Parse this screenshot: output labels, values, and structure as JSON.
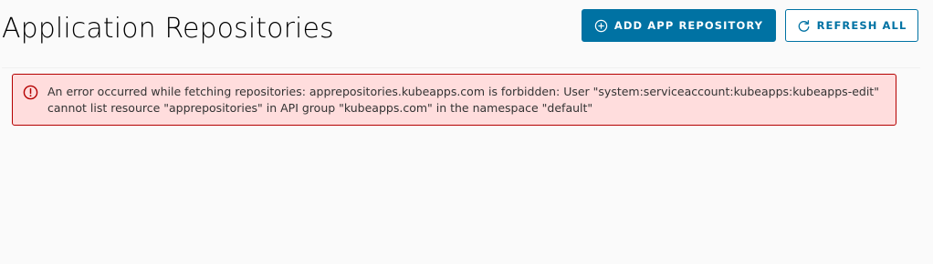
{
  "page": {
    "title": "Application Repositories"
  },
  "toolbar": {
    "add_button": {
      "label": "ADD APP REPOSITORY",
      "icon": "plus-circle-icon"
    },
    "refresh_button": {
      "label": "REFRESH ALL",
      "icon": "refresh-icon"
    }
  },
  "alert": {
    "type": "error",
    "icon": "error-circle-icon",
    "message": "An error occurred while fetching repositories: apprepositories.kubeapps.com is forbidden: User \"system:serviceaccount:kubeapps:kubeapps-edit\" cannot list resource \"apprepositories\" in API group \"kubeapps.com\" in the namespace \"default\""
  },
  "colors": {
    "primary": "#0072a3",
    "error_border": "#b50000",
    "error_background": "#ffdddd",
    "page_background": "#fafafa"
  }
}
